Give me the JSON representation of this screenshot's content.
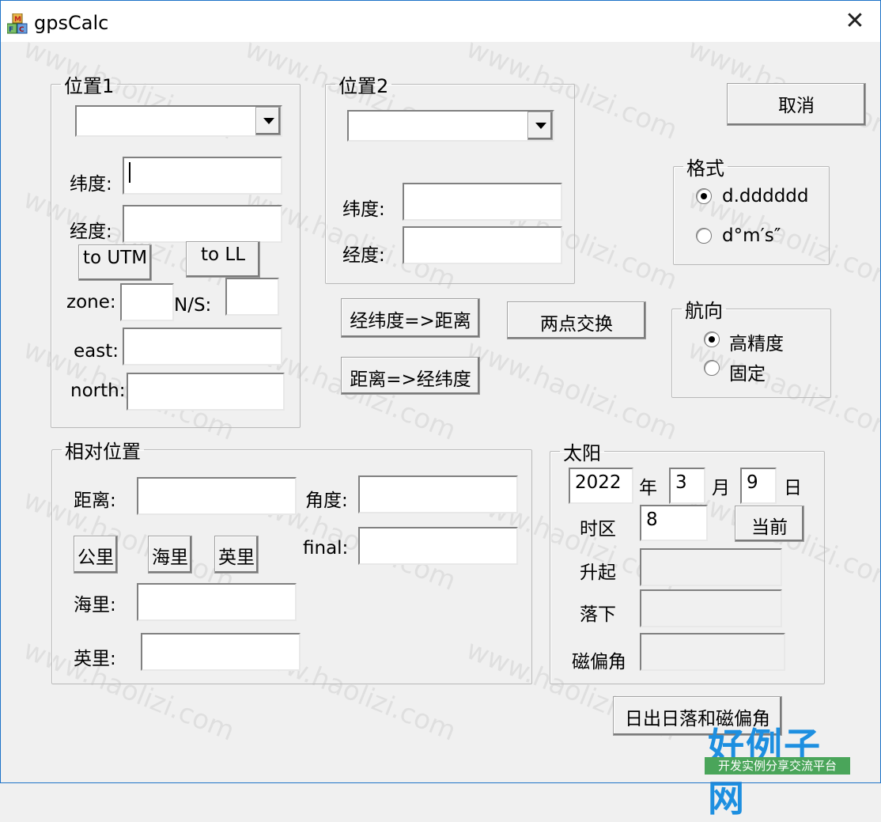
{
  "window": {
    "title": "gpsCalc",
    "close": "✕"
  },
  "pos1": {
    "legend": "位置1",
    "combo_value": "",
    "lat_label": "纬度:",
    "lat_value": "",
    "lon_label": "经度:",
    "lon_value": "",
    "to_utm": "to UTM",
    "to_ll": "to LL",
    "zone_label": "zone:",
    "zone_value": "",
    "ns_label": "N/S:",
    "ns_value": "",
    "east_label": "east:",
    "east_value": "",
    "north_label": "north:",
    "north_value": ""
  },
  "pos2": {
    "legend": "位置2",
    "combo_value": "",
    "lat_label": "纬度:",
    "lat_value": "",
    "lon_label": "经度:",
    "lon_value": ""
  },
  "actions": {
    "cancel": "取消",
    "ll_to_dist": "经纬度=>距离",
    "swap": "两点交换",
    "dist_to_ll": "距离=>经纬度"
  },
  "format": {
    "legend": "格式",
    "options": [
      {
        "label": "d.dddddd",
        "checked": true
      },
      {
        "label": "d°m′s″",
        "checked": false
      }
    ]
  },
  "heading": {
    "legend": "航向",
    "options": [
      {
        "label": "高精度",
        "checked": true
      },
      {
        "label": "固定",
        "checked": false
      }
    ]
  },
  "relative": {
    "legend": "相对位置",
    "dist_label": "距离:",
    "dist_value": "",
    "angle_label": "角度:",
    "angle_value": "",
    "final_label": "final:",
    "final_value": "",
    "km_btn": "公里",
    "nmi_btn": "海里",
    "mi_btn": "英里",
    "nmi_label": "海里:",
    "nmi_value": "",
    "mi_label": "英里:",
    "mi_value": ""
  },
  "sun": {
    "legend": "太阳",
    "year_value": "2022",
    "year_label": "年",
    "month_value": "3",
    "month_label": "月",
    "day_value": "9",
    "day_label": "日",
    "tz_label": "时区",
    "tz_value": "8",
    "now_btn": "当前",
    "rise_label": "升起",
    "rise_value": "",
    "set_label": "落下",
    "set_value": "",
    "decl_label": "磁偏角",
    "decl_value": "",
    "calc_btn": "日出日落和磁偏角"
  },
  "overlay": {
    "watermark_text": "www.haolizi.com",
    "logo_title": "好例子网",
    "logo_subtitle": "开发实例分享交流平台"
  }
}
